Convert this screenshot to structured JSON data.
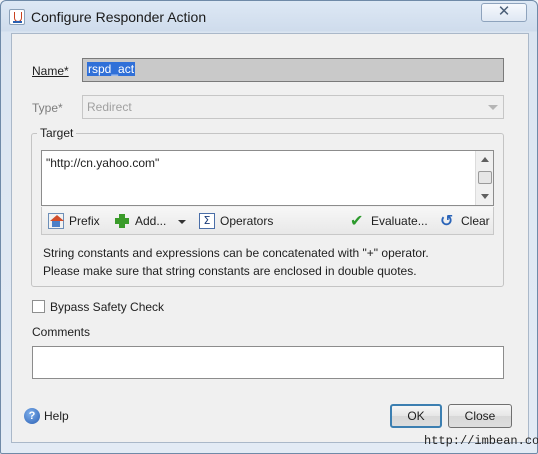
{
  "window": {
    "title": "Configure Responder Action",
    "close_glyph": "✕"
  },
  "form": {
    "name_label": "Name*",
    "name_value": "rspd_act",
    "type_label": "Type*",
    "type_value": "Redirect",
    "target_group_label": "Target",
    "target_value": "\"http://cn.yahoo.com\"",
    "toolbar": {
      "prefix_label": "Prefix",
      "add_label": "Add...",
      "operators_label": "Operators",
      "evaluate_label": "Evaluate...",
      "clear_label": "Clear"
    },
    "help_line_1": "String constants and expressions can be concatenated with \"+\" operator.",
    "help_line_2": "Please make sure that string constants are enclosed in double quotes.",
    "bypass_label": "Bypass Safety Check",
    "bypass_checked": false,
    "comments_label": "Comments",
    "comments_value": ""
  },
  "footer": {
    "help_label": "Help",
    "ok_label": "OK",
    "close_label": "Close"
  },
  "watermark": "http://imbean.com",
  "icons": {
    "app": "java-cup-icon",
    "prefix": "home-icon",
    "add": "plus-icon",
    "operators": "sigma-icon",
    "evaluate": "checkmark-icon",
    "clear": "undo-arrow-icon",
    "help": "question-icon"
  },
  "colors": {
    "selection": "#3070d8",
    "default_button_border": "#3c7fb1",
    "add_icon": "#3a9b2a"
  }
}
